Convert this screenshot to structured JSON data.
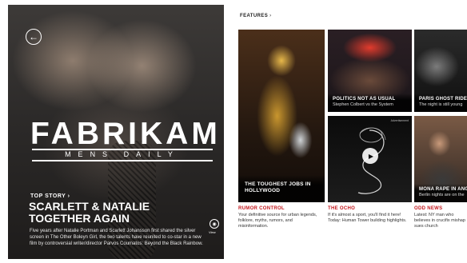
{
  "hero": {
    "back_icon": "back-arrow-icon",
    "brand": "FABRIKAM",
    "subbrand": "MENS DAILY",
    "kicker": "TOP STORY ›",
    "headline_line1": "SCARLETT & NATALIE",
    "headline_line2": "TOGETHER AGAIN",
    "blurb": "Five years after Natalie Portman and Scarlett Johansson first shared the silver screen in The Other Boleyn Girl, the two talents have reunited to co-star in a new film by controversial writer/director Parvos Coumatos: Beyond the Black Rainbow.",
    "view_icon": "eye-icon",
    "view_label": "View"
  },
  "features": {
    "title": "FEATURES",
    "chevron": "›",
    "tiles": [
      {
        "title_line1": "THE TOUGHEST JOBS IN",
        "title_line2": "HOLLYWOOD",
        "subtitle": "",
        "section": "RUMOR CONTROL",
        "description": "Your definitive source for urban legends, folklore, myths, rumors, and misinformation."
      },
      {
        "title_line1": "POLITICS NOT AS USUAL",
        "title_line2": "",
        "subtitle": "Stephen Colbert vs the System",
        "section": "THE OCHO",
        "description": "If it's almost a sport, you'll find it here! Today: Human Tower building highlights."
      },
      {
        "title_line1": "PARIS GHOST RIDERS",
        "title_line2": "",
        "subtitle": "The night is still young",
        "section": "ODD NEWS",
        "description": "Latest: NY man who believes in crucifix mishap sues church"
      },
      {
        "title_line1": "",
        "title_line2": "",
        "subtitle": "",
        "badge": "Advertisement",
        "play_icon": "play-icon"
      },
      {
        "title_line1": "MONA RAPE IN ANG",
        "title_line2": "",
        "subtitle": "Berlin nights are on the"
      }
    ]
  },
  "colors": {
    "accent": "#c4161c",
    "hero_text": "#ffffff",
    "background": "#ffffff"
  }
}
